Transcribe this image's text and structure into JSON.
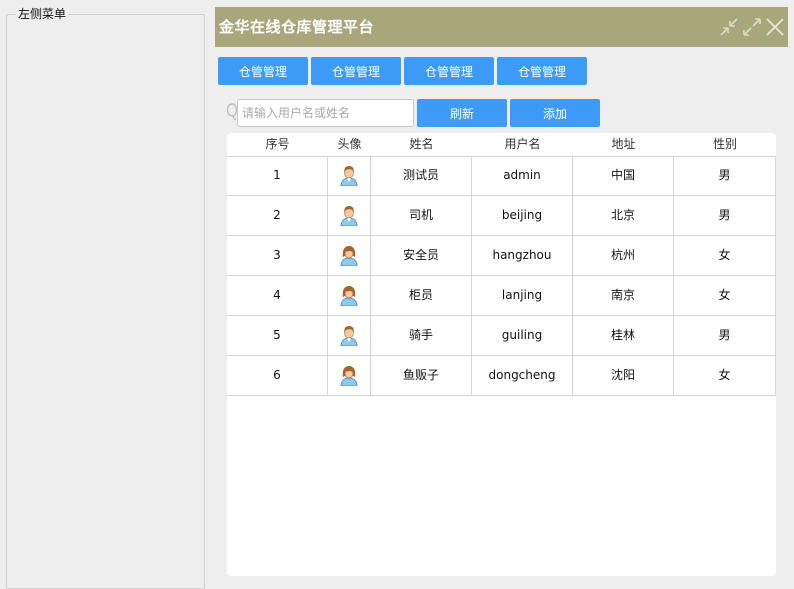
{
  "left_menu": {
    "title": "左侧菜单"
  },
  "header": {
    "title": "金华在线仓库管理平台"
  },
  "window_controls": [
    {
      "name": "minimize-icon"
    },
    {
      "name": "restore-icon"
    },
    {
      "name": "close-icon"
    }
  ],
  "nav_buttons": [
    {
      "label": "仓管管理"
    },
    {
      "label": "仓管管理"
    },
    {
      "label": "仓管管理"
    },
    {
      "label": "仓管管理"
    }
  ],
  "search": {
    "placeholder": "请输入用户名或姓名",
    "value": "",
    "icon": "search-icon"
  },
  "actions": {
    "refresh_label": "刷新",
    "add_label": "添加"
  },
  "colors": {
    "titlebar": "#a8a77b",
    "button": "#3d9bf7",
    "background": "#eeeeee"
  },
  "table": {
    "columns": [
      "序号",
      "头像",
      "姓名",
      "用户名",
      "地址",
      "性别"
    ],
    "rows": [
      {
        "index": "1",
        "avatar": "male-avatar-icon",
        "name": "测试员",
        "username": "admin",
        "address": "中国",
        "gender": "男"
      },
      {
        "index": "2",
        "avatar": "male-avatar-icon",
        "name": "司机",
        "username": "beijing",
        "address": "北京",
        "gender": "男"
      },
      {
        "index": "3",
        "avatar": "female-avatar-icon",
        "name": "安全员",
        "username": "hangzhou",
        "address": "杭州",
        "gender": "女"
      },
      {
        "index": "4",
        "avatar": "female-avatar-icon",
        "name": "柜员",
        "username": "lanjing",
        "address": "南京",
        "gender": "女"
      },
      {
        "index": "5",
        "avatar": "male-avatar-icon",
        "name": "骑手",
        "username": "guiling",
        "address": "桂林",
        "gender": "男"
      },
      {
        "index": "6",
        "avatar": "female-avatar-icon",
        "name": "鱼贩子",
        "username": "dongcheng",
        "address": "沈阳",
        "gender": "女"
      }
    ]
  }
}
